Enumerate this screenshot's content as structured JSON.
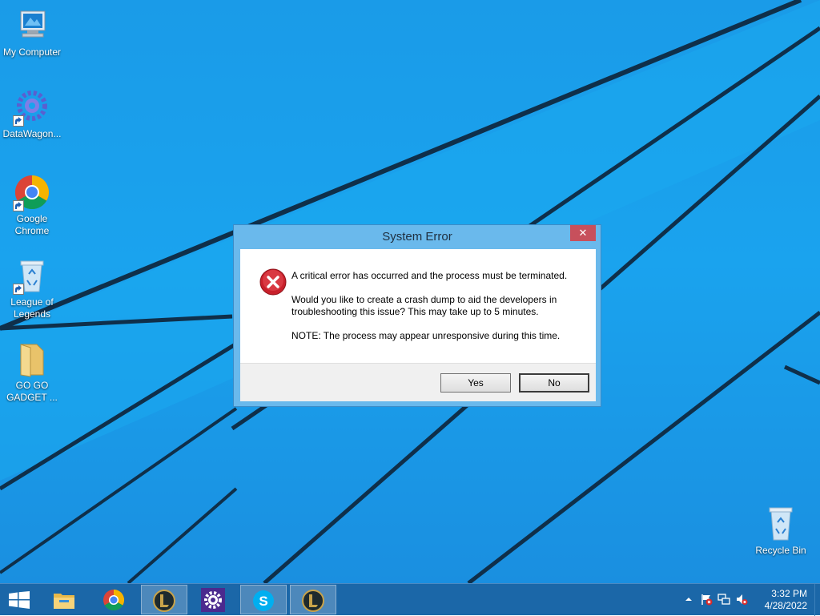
{
  "desktop": {
    "icons": [
      {
        "label": "My Computer"
      },
      {
        "label": "DataWagon..."
      },
      {
        "label": "Google Chrome"
      },
      {
        "label": "League of Legends"
      },
      {
        "label": "GO GO GADGET ..."
      },
      {
        "label": "Recycle Bin"
      }
    ]
  },
  "dialog": {
    "title": "System Error",
    "close_label": "✕",
    "message1": "A critical error has occurred and the process must be terminated.",
    "message2": "Would you like to create a crash dump to aid the developers in troubleshooting this issue? This may take up to 5 minutes.",
    "message3": "NOTE: The process may appear unresponsive during this time.",
    "yes_label": "Yes",
    "no_label": "No",
    "icon": "error-icon"
  },
  "taskbar": {
    "items": [
      {
        "icon": "windows-start-icon"
      },
      {
        "icon": "file-explorer-icon"
      },
      {
        "icon": "chrome-icon"
      },
      {
        "icon": "league-of-legends-icon"
      },
      {
        "icon": "settings-gear-icon"
      },
      {
        "icon": "skype-icon"
      },
      {
        "icon": "league-of-legends-icon"
      }
    ],
    "tray": {
      "time": "3:32 PM",
      "date": "4/28/2022"
    }
  },
  "colors": {
    "desktop_bg": "#1a9be8",
    "taskbar_bg": "#1b67a8",
    "dialog_frame": "#6ab9ec",
    "close_button": "#c7505c"
  }
}
